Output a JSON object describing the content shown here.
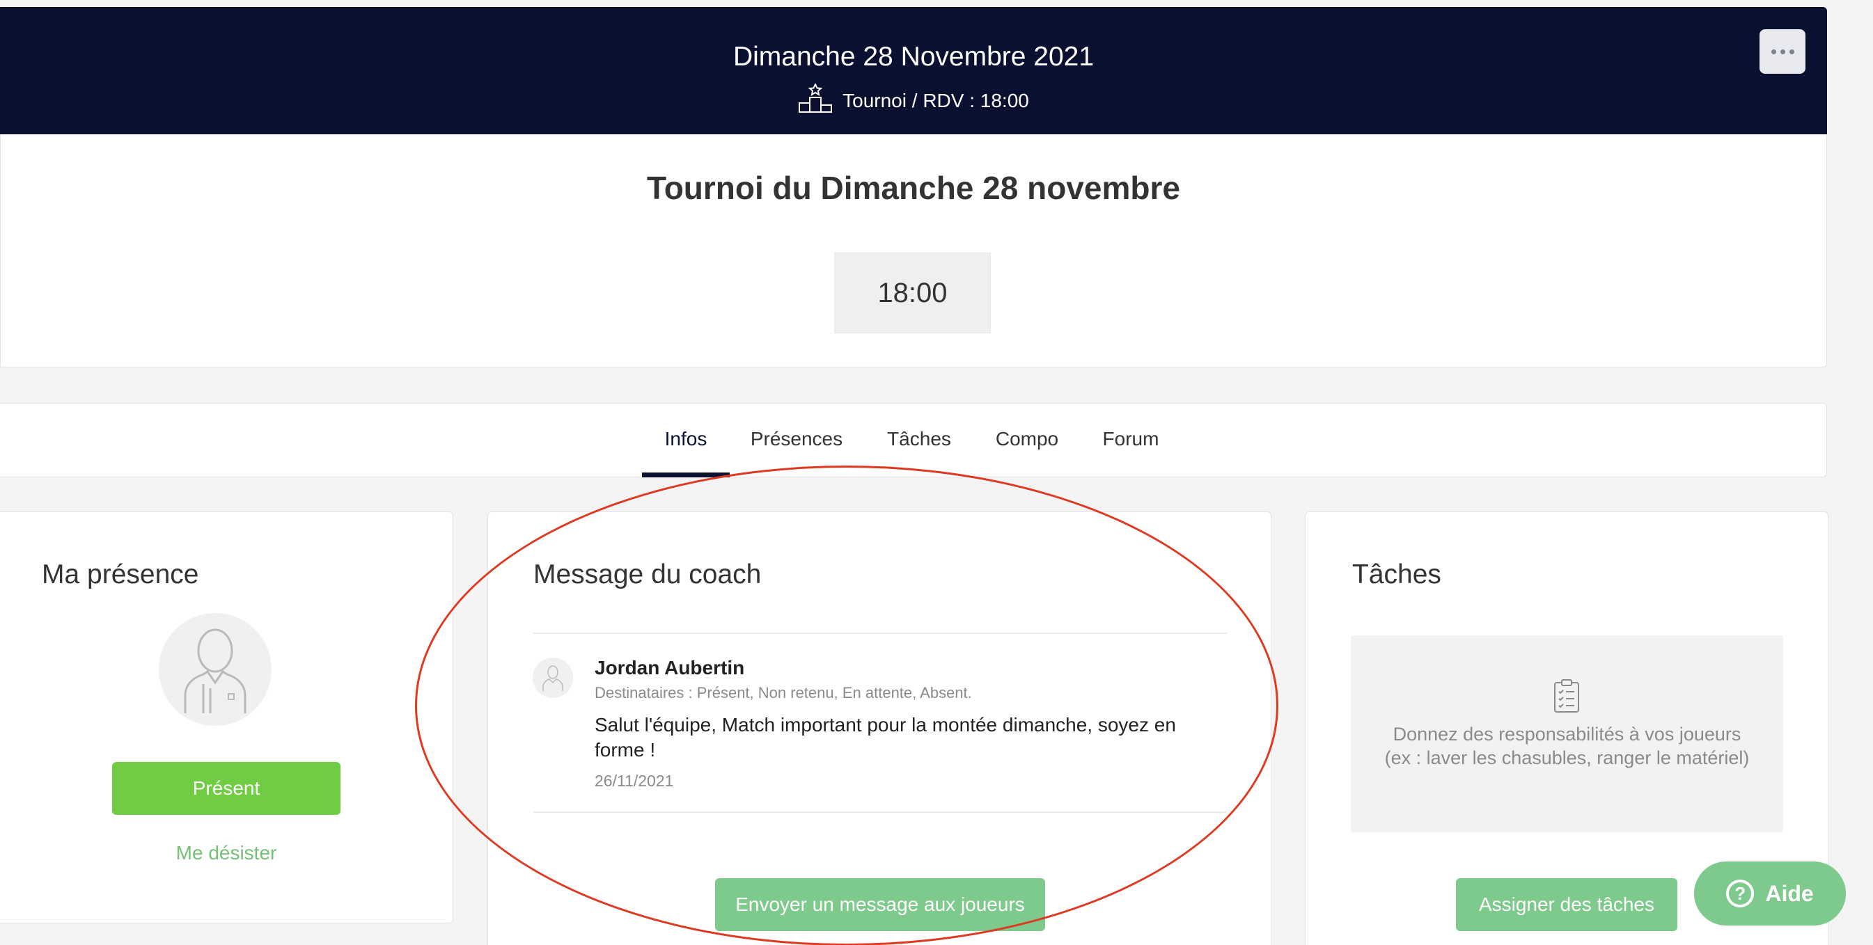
{
  "header": {
    "date": "Dimanche 28 Novembre 2021",
    "subtitle": "Tournoi / RDV : 18:00",
    "event_icon": "podium-icon",
    "more_icon": "more-horizontal-icon"
  },
  "event": {
    "title": "Tournoi du Dimanche 28 novembre",
    "time": "18:00"
  },
  "tabs": [
    {
      "label": "Infos",
      "active": true
    },
    {
      "label": "Présences",
      "active": false
    },
    {
      "label": "Tâches",
      "active": false
    },
    {
      "label": "Compo",
      "active": false
    },
    {
      "label": "Forum",
      "active": false
    }
  ],
  "presence": {
    "title": "Ma présence",
    "avatar_icon": "player-avatar-icon",
    "status_button": "Présent",
    "withdraw_link": "Me désister"
  },
  "coach_message": {
    "title": "Message du coach",
    "author": "Jordan Aubertin",
    "recipients": "Destinataires : Présent, Non retenu, En attente, Absent.",
    "body": "Salut l'équipe, Match important pour la montée dimanche, soyez en forme !",
    "date": "26/11/2021",
    "send_button": "Envoyer un message aux joueurs"
  },
  "tasks": {
    "title": "Tâches",
    "empty_icon": "clipboard-checklist-icon",
    "empty_text": "Donnez des responsabilités à vos joueurs (ex : laver les chasubles, ranger le matériel)",
    "assign_button": "Assigner des tâches"
  },
  "help": {
    "label": "Aide",
    "icon": "question-circle-icon"
  },
  "colors": {
    "header_bg": "#0a1130",
    "green_primary": "#6fcc43",
    "green_soft": "#7ec98c",
    "annotation_red": "#de3a22"
  }
}
